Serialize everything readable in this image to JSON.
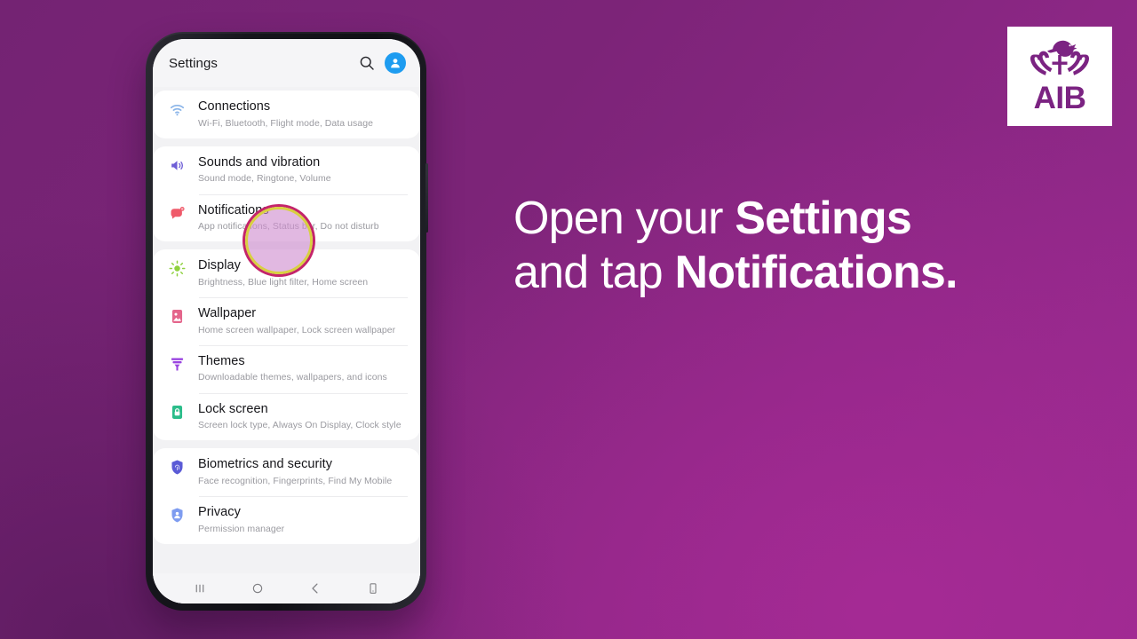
{
  "background": {
    "gradient_from": "#742373",
    "gradient_to": "#9a2a90"
  },
  "logo": {
    "name": "AIB",
    "wordmark": "AIB",
    "color": "#7b2382",
    "mark_icon": "aib-ark-bird-icon"
  },
  "headline": {
    "line1_plain": "Open your ",
    "line1_bold": "Settings",
    "line2_plain": "and tap ",
    "line2_bold": "Notifications."
  },
  "phone": {
    "appbar": {
      "title": "Settings",
      "search_icon": "search-icon",
      "avatar_icon": "account-avatar-icon",
      "avatar_color": "#1e9cf0"
    },
    "highlight": {
      "target": "Notifications",
      "fill": "#ce8cce",
      "ring_inner": "#d8d041",
      "ring_outer": "#c4246b"
    },
    "groups": [
      {
        "rows": [
          {
            "icon": "wifi-icon",
            "icon_color": "#8ab4e8",
            "title": "Connections",
            "subtitle": "Wi-Fi, Bluetooth, Flight mode, Data usage"
          }
        ]
      },
      {
        "rows": [
          {
            "icon": "speaker-volume-icon",
            "icon_color": "#6f5fd6",
            "title": "Sounds and vibration",
            "subtitle": "Sound mode, Ringtone, Volume"
          },
          {
            "icon": "notification-bubble-icon",
            "icon_color": "#ef5a6a",
            "title": "Notifications",
            "subtitle": "App notifications, Status bar, Do not disturb"
          }
        ]
      },
      {
        "rows": [
          {
            "icon": "brightness-sun-icon",
            "icon_color": "#8fd13f",
            "title": "Display",
            "subtitle": "Brightness, Blue light filter, Home screen"
          },
          {
            "icon": "wallpaper-image-icon",
            "icon_color": "#e4658b",
            "title": "Wallpaper",
            "subtitle": "Home screen wallpaper, Lock screen wallpaper"
          },
          {
            "icon": "themes-paint-icon",
            "icon_color": "#9a44e0",
            "title": "Themes",
            "subtitle": "Downloadable themes, wallpapers, and icons"
          },
          {
            "icon": "lock-screen-icon",
            "icon_color": "#2bbd8a",
            "title": "Lock screen",
            "subtitle": "Screen lock type, Always On Display, Clock style"
          }
        ]
      },
      {
        "rows": [
          {
            "icon": "shield-fingerprint-icon",
            "icon_color": "#5b5bd6",
            "title": "Biometrics and security",
            "subtitle": "Face recognition, Fingerprints, Find My Mobile"
          },
          {
            "icon": "privacy-shield-person-icon",
            "icon_color": "#7e9cf0",
            "title": "Privacy",
            "subtitle": "Permission manager"
          }
        ]
      }
    ],
    "navbar": {
      "recents_icon": "recents-icon",
      "home_icon": "home-circle-icon",
      "back_icon": "back-chevron-icon",
      "extra_icon": "screen-capture-icon"
    }
  }
}
